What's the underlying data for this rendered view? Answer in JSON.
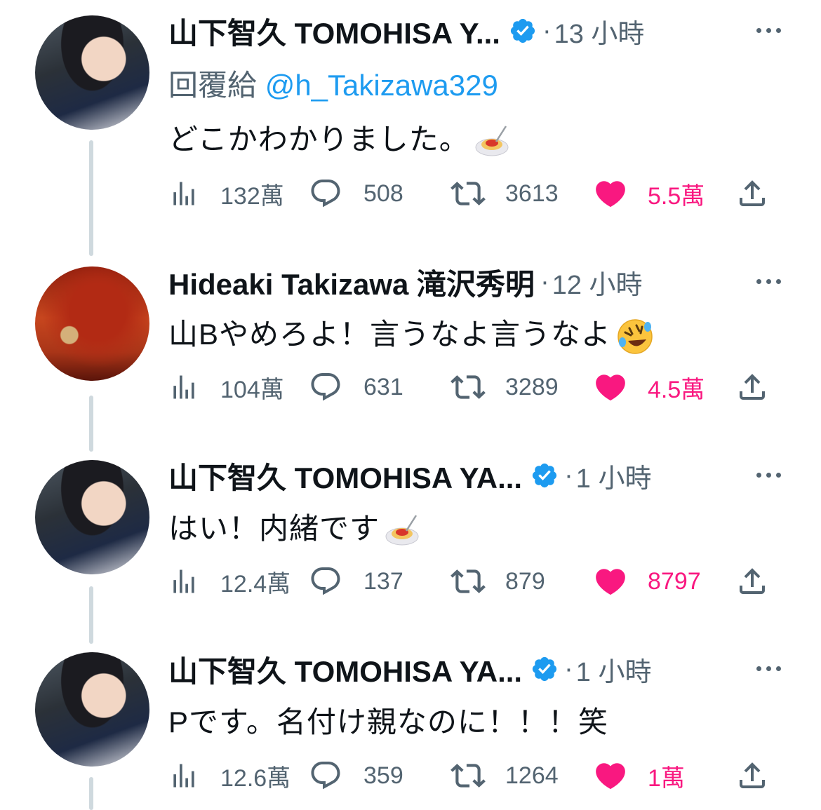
{
  "tweets": [
    {
      "author": "山下智久 TOMOHISA Y...",
      "time": "13 小時",
      "reply_label": "回覆給",
      "reply_mention": "@h_Takizawa329",
      "text": "どこかわかりました。",
      "emoji": "spaghetti-emoji",
      "stats": {
        "views": "132萬",
        "replies": "508",
        "reposts": "3613",
        "likes": "5.5萬"
      }
    },
    {
      "author": "Hideaki Takizawa 滝沢秀明",
      "time": "12 小時",
      "text": "山Bやめろよ！言うなよ言うなよ",
      "emoji": "rolling-laughing-emoji",
      "stats": {
        "views": "104萬",
        "replies": "631",
        "reposts": "3289",
        "likes": "4.5萬"
      }
    },
    {
      "author": "山下智久 TOMOHISA YA...",
      "time": "1 小時",
      "text": "はい！内緒です",
      "emoji": "spaghetti-emoji",
      "stats": {
        "views": "12.4萬",
        "replies": "137",
        "reposts": "879",
        "likes": "8797"
      }
    },
    {
      "author": "山下智久 TOMOHISA YA...",
      "time": "1 小時",
      "text": "Pです。名付け親なのに！！！笑",
      "stats": {
        "views": "12.6萬",
        "replies": "359",
        "reposts": "1264",
        "likes": "1萬"
      }
    }
  ],
  "colors": {
    "verified": "#1d9bf0",
    "like": "#f91880",
    "muted": "#536471",
    "thread_line": "#cfd9de"
  }
}
